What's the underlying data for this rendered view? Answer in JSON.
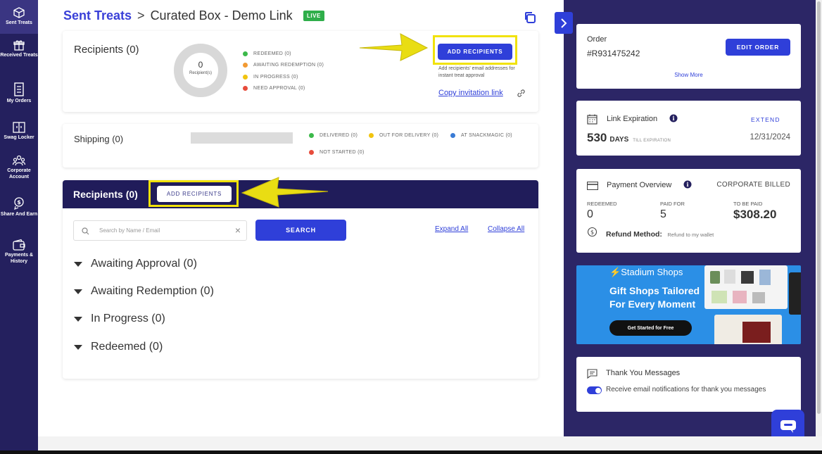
{
  "nav": [
    {
      "label": "Sent Treats",
      "icon": "box-icon",
      "active": true
    },
    {
      "label": "Received Treats",
      "icon": "gift-icon",
      "active": false
    },
    {
      "label": "My Orders",
      "icon": "orders-icon",
      "active": false
    },
    {
      "label": "Swag Locker",
      "icon": "locker-icon",
      "active": false
    },
    {
      "label": "Corporate Account",
      "icon": "team-icon",
      "active": false
    },
    {
      "label": "Share And Earn",
      "icon": "share-icon",
      "active": false
    },
    {
      "label": "Payments & History",
      "icon": "wallet-icon",
      "active": false
    }
  ],
  "header": {
    "breadcrumb_root": "Sent Treats",
    "separator": ">",
    "current": "Curated Box - Demo Link",
    "status_badge": "LIVE"
  },
  "recipients_summary": {
    "title": "Recipients (0)",
    "donut_count": "0",
    "donut_label": "Recipient(s)",
    "legend": [
      {
        "label": "REDEEMED (0)",
        "color": "#3cb94a"
      },
      {
        "label": "AWAITING REDEMPTION (0)",
        "color": "#f29a33"
      },
      {
        "label": "IN PROGRESS (0)",
        "color": "#f1c40f"
      },
      {
        "label": "NEED APPROVAL (0)",
        "color": "#e74c3c"
      }
    ],
    "add_button": "ADD RECIPIENTS",
    "helper_line1": "Add recipients' email addresses for",
    "helper_line2": "instant treat approval",
    "copy_link": "Copy invitation link"
  },
  "shipping": {
    "title": "Shipping (0)",
    "legend": [
      {
        "label": "DELIVERED (0)",
        "color": "#3cb94a"
      },
      {
        "label": "OUT FOR DELIVERY (0)",
        "color": "#f1c40f"
      },
      {
        "label": "AT SNACKMAGIC (0)",
        "color": "#3a7bd5"
      },
      {
        "label": "NOT STARTED (0)",
        "color": "#e74c3c"
      }
    ]
  },
  "recipients_list": {
    "title": "Recipients (0)",
    "add_button": "ADD RECIPIENTS",
    "search_placeholder": "Search by Name / Email",
    "search_button": "SEARCH",
    "expand_all": "Expand All",
    "collapse_all": "Collapse All",
    "groups": [
      "Awaiting Approval (0)",
      "Awaiting Redemption (0)",
      "In Progress (0)",
      "Redeemed (0)"
    ]
  },
  "order": {
    "label": "Order",
    "number": "#R931475242",
    "edit_button": "EDIT ORDER",
    "show_more": "Show More"
  },
  "expiration": {
    "title": "Link Expiration",
    "extend": "EXTEND",
    "days": "530",
    "days_unit": "DAYS",
    "till": "TILL EXPIRATION",
    "date": "12/31/2024"
  },
  "payment": {
    "title": "Payment Overview",
    "billing": "CORPORATE BILLED",
    "redeemed_label": "REDEEMED",
    "redeemed_value": "0",
    "paid_label": "PAID FOR",
    "paid_value": "5",
    "due_label": "TO BE PAID",
    "due_value": "$308.20",
    "refund_label": "Refund Method:",
    "refund_value": "Refund to my wallet"
  },
  "banner": {
    "brand": "Stadium Shops",
    "headline_line1": "Gift Shops Tailored",
    "headline_line2": "For Every Moment",
    "cta": "Get Started for Free"
  },
  "thank_you": {
    "title": "Thank You Messages",
    "toggle_label": "Receive email notifications for thank you messages",
    "enabled": true
  },
  "colors": {
    "nav_bg": "#24205e",
    "accent": "#2f3fd9",
    "highlight": "#f1e20a",
    "right_panel_bg": "#2c2666",
    "live": "#2fae4a"
  }
}
